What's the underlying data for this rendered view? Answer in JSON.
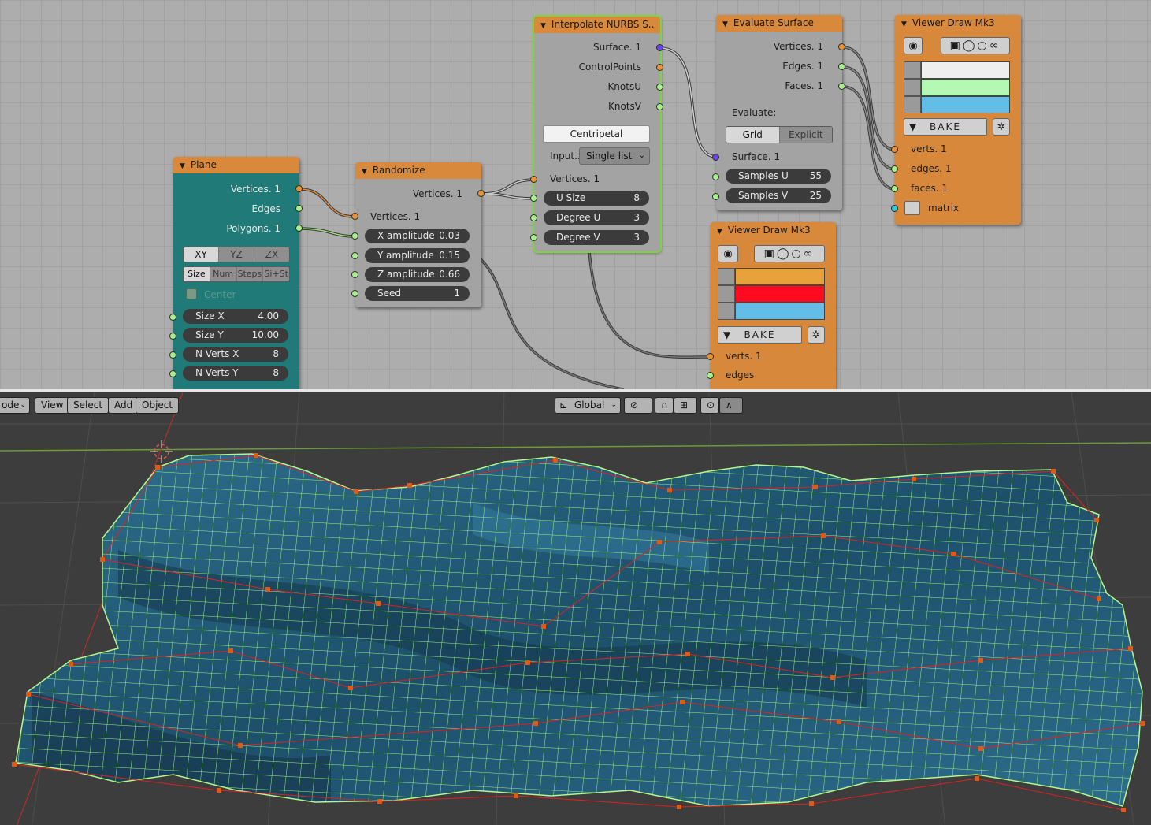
{
  "plane": {
    "title": "Plane",
    "outputs": [
      "Vertices. 1",
      "Edges",
      "Polygons. 1"
    ],
    "modes": [
      "XY",
      "YZ",
      "ZX"
    ],
    "size_modes": [
      "Size",
      "Num",
      "Steps",
      "Si+St"
    ],
    "center_label": "Center",
    "fields": [
      {
        "label": "Size X",
        "value": "4.00"
      },
      {
        "label": "Size Y",
        "value": "10.00"
      },
      {
        "label": "N Verts X",
        "value": "8"
      },
      {
        "label": "N Verts Y",
        "value": "8"
      }
    ]
  },
  "randomize": {
    "title": "Randomize",
    "output": "Vertices. 1",
    "input": "Vertices. 1",
    "fields": [
      {
        "label": "X amplitude",
        "value": "0.03"
      },
      {
        "label": "Y amplitude",
        "value": "0.15"
      },
      {
        "label": "Z amplitude",
        "value": "0.66"
      },
      {
        "label": "Seed",
        "value": "1"
      }
    ]
  },
  "interp": {
    "title": "Interpolate NURBS S..",
    "outputs": [
      "Surface. 1",
      "ControlPoints",
      "KnotsU",
      "KnotsV"
    ],
    "mode_button": "Centripetal",
    "input_label": "Input..",
    "input_value": "Single list",
    "input_socket": "Vertices. 1",
    "fields": [
      {
        "label": "U Size",
        "value": "8"
      },
      {
        "label": "Degree U",
        "value": "3"
      },
      {
        "label": "Degree V",
        "value": "3"
      }
    ]
  },
  "evalsurf": {
    "title": "Evaluate Surface",
    "outputs": [
      "Vertices. 1",
      "Edges. 1",
      "Faces. 1"
    ],
    "evaluate_label": "Evaluate:",
    "evaluate_modes": [
      "Grid",
      "Explicit"
    ],
    "input_socket": "Surface. 1",
    "fields": [
      {
        "label": "Samples U",
        "value": "55"
      },
      {
        "label": "Samples V",
        "value": "25"
      }
    ]
  },
  "viewer1": {
    "title": "Viewer Draw Mk3",
    "bake": "BAKE",
    "inputs": [
      "verts. 1",
      "edges. 1",
      "faces. 1",
      "matrix"
    ],
    "colors": [
      "#eeeeee",
      "#b4f8b4",
      "#63bde6"
    ]
  },
  "viewer2": {
    "title": "Viewer Draw Mk3",
    "bake": "BAKE",
    "inputs": [
      "verts. 1",
      "edges"
    ],
    "colors": [
      "#e8a23c",
      "#ff0a1e",
      "#63bde6"
    ]
  },
  "viewport": {
    "menu": [
      "ode",
      "View",
      "Select",
      "Add",
      "Object"
    ],
    "orientation": "Global"
  }
}
